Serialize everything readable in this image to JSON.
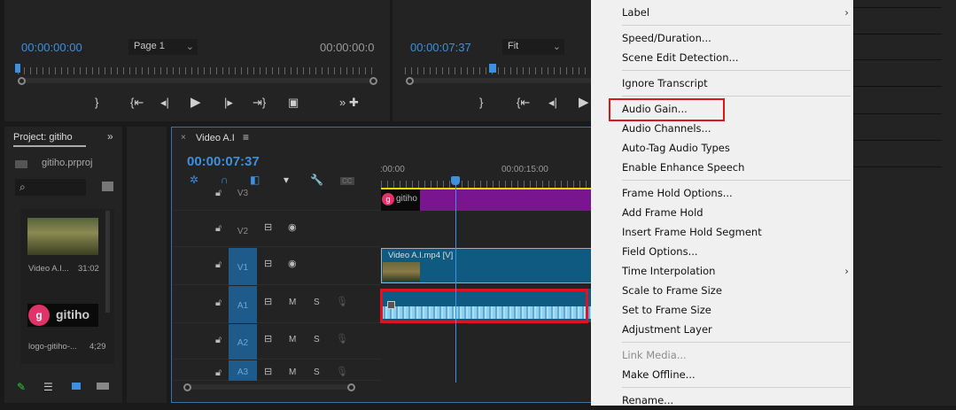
{
  "source_monitor": {
    "timecode_in": "00:00:00:00",
    "page_select": "Page 1",
    "timecode_out": "00:00:00:0"
  },
  "program_monitor": {
    "timecode": "00:00:07:37",
    "fit_select": "Fit"
  },
  "project": {
    "tab": "Project: gitiho",
    "file": "gitiho.prproj",
    "search_placeholder": "",
    "items": [
      {
        "name": "Video A.I...",
        "duration": "31:02"
      },
      {
        "name": "logo-gitiho-...",
        "duration": "4;29"
      }
    ],
    "logo_text": "gitiho"
  },
  "timeline": {
    "tab": "Video A.I",
    "timecode": "00:00:07:37",
    "ruler": [
      ":00:00",
      "00:00:15:00"
    ],
    "tracks": [
      {
        "name": "V3",
        "active": false
      },
      {
        "name": "V2",
        "active": false
      },
      {
        "name": "V1",
        "active": true
      },
      {
        "name": "A1",
        "active": true
      },
      {
        "name": "A2",
        "active": true
      },
      {
        "name": "A3",
        "active": true
      }
    ],
    "audio_toggles": {
      "mute": "M",
      "solo": "S"
    },
    "clips": {
      "v3": "gitiho",
      "v1": "Video A.I.mp4 [V]"
    },
    "cc": "CC"
  },
  "context_menu": {
    "items": [
      {
        "label": "Label",
        "submenu": true
      },
      {
        "sep": true
      },
      {
        "label": "Speed/Duration..."
      },
      {
        "label": "Scene Edit Detection..."
      },
      {
        "sep": true
      },
      {
        "label": "Ignore Transcript"
      },
      {
        "sep": true
      },
      {
        "label": "Audio Gain...",
        "highlighted": true
      },
      {
        "label": "Audio Channels..."
      },
      {
        "label": "Auto-Tag Audio Types"
      },
      {
        "label": "Enable Enhance Speech"
      },
      {
        "sep": true
      },
      {
        "label": "Frame Hold Options..."
      },
      {
        "label": "Add Frame Hold"
      },
      {
        "label": "Insert Frame Hold Segment"
      },
      {
        "label": "Field Options..."
      },
      {
        "label": "Time Interpolation",
        "submenu": true
      },
      {
        "label": "Scale to Frame Size"
      },
      {
        "label": "Set to Frame Size"
      },
      {
        "label": "Adjustment Layer"
      },
      {
        "sep": true
      },
      {
        "label": "Link Media...",
        "disabled": true
      },
      {
        "label": "Make Offline..."
      },
      {
        "sep": true
      },
      {
        "label": "Rename..."
      }
    ]
  },
  "colors": {
    "accent": "#3d8fe0",
    "highlight_box": "#e0141e",
    "clip_video": "#0f5a80",
    "clip_graphic": "#7a1590",
    "menu_bg": "#f0f0f0"
  }
}
